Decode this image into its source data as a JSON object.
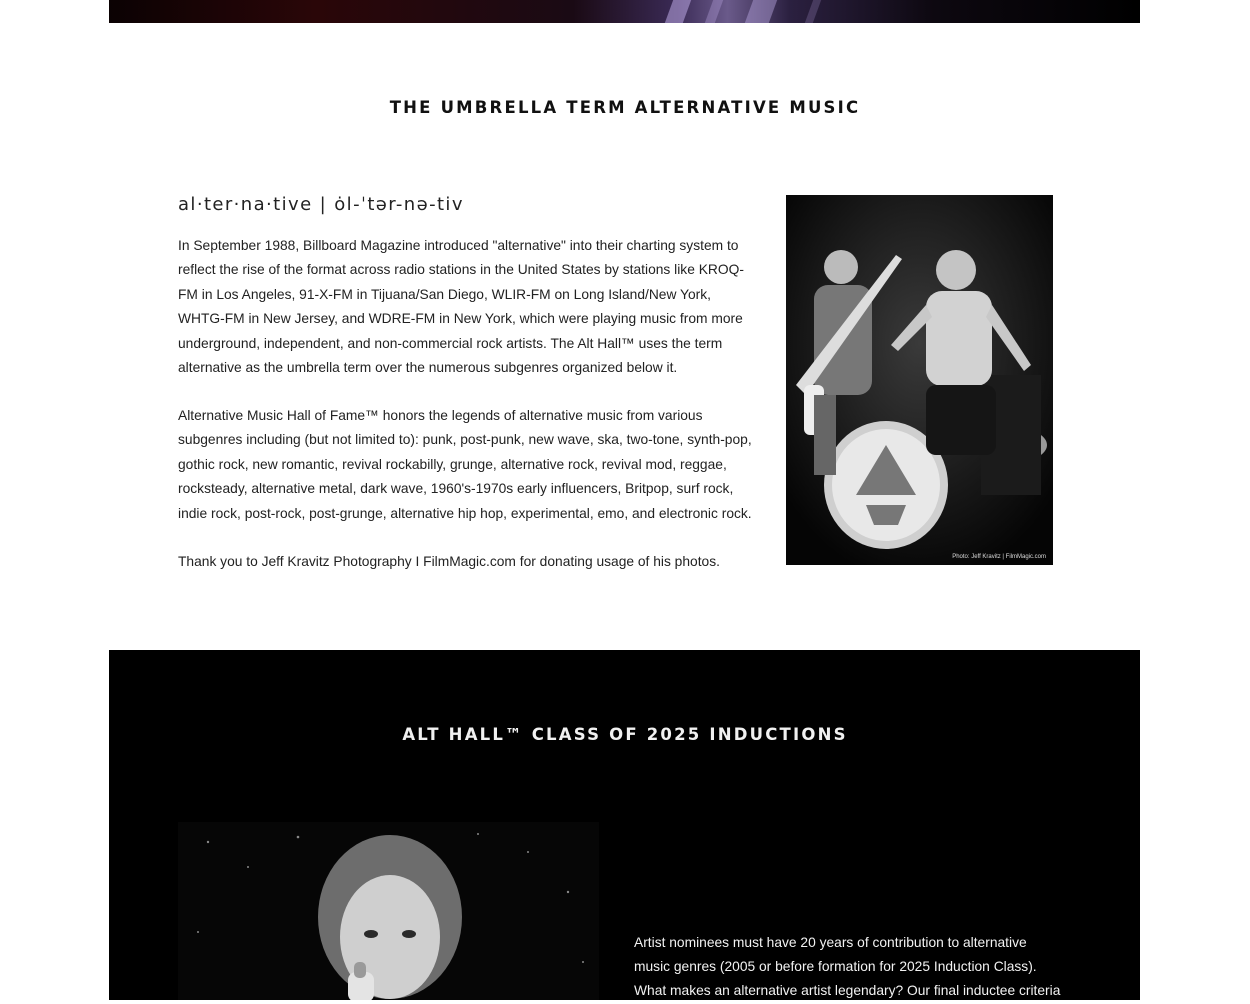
{
  "hero": {
    "image": "concert-hero-photo"
  },
  "umbrella_section": {
    "title": "THE UMBRELLA TERM ALTERNATIVE MUSIC",
    "definition": "al·ter·na·tive | ȯl-ˈtər-nə-tiv",
    "paragraphs": [
      "In September 1988, Billboard Magazine introduced \"alternative\" into their charting system to reflect the rise of the format across radio stations in the United States by stations like KROQ-FM in Los Angeles, 91-X-FM in Tijuana/San Diego, WLIR-FM on Long Island/New York, WHTG-FM in New Jersey, and WDRE-FM in New York, which were playing music from more underground, independent, and non-commercial rock artists. The Alt Hall™ uses the term alternative as the umbrella term over the numerous subgenres organized below it.",
      "Alternative Music Hall of Fame™ honors the legends of alternative music from various subgenres including (but not limited to): punk, post-punk, new wave, ska, two-tone, synth-pop, gothic rock, new romantic, revival rockabilly, grunge, alternative rock, revival mod, reggae, rocksteady, alternative metal, dark wave, 1960's-1970s early influencers, Britpop, surf rock, indie rock, post-rock, post-grunge, alternative hip hop, experimental, emo, and electronic rock.",
      "Thank you to Jeff Kravitz Photography I FilmMagic.com for donating usage of his photos."
    ],
    "photo_credit": "Photo: Jeff Kravitz | FilmMagic.com"
  },
  "inductions_section": {
    "title": "ALT HALL™ CLASS OF 2025 INDUCTIONS",
    "body": "Artist nominees must have 20 years of contribution to alternative music genres (2005 or before formation for 2025 Induction Class). What makes an alternative artist legendary? Our final inductee criteria"
  },
  "colors": {
    "page_background": "#ffffff",
    "inductions_background": "#000000",
    "heading_dark": "#111111",
    "heading_light": "#f1f1f1"
  }
}
